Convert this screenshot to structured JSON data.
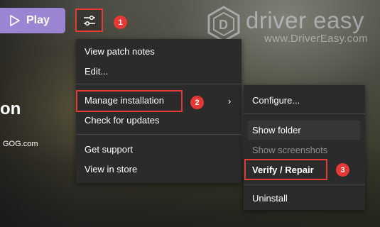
{
  "play_button": {
    "label": "Play"
  },
  "watermark": {
    "brand": "driver easy",
    "url": "www.DriverEasy.com"
  },
  "game": {
    "title_fragment": "on",
    "store": "GOG.com"
  },
  "steps": [
    "1",
    "2",
    "3"
  ],
  "menu": {
    "items": [
      {
        "label": "View patch notes"
      },
      {
        "label": "Edit..."
      },
      {
        "label": "Manage installation",
        "has_submenu": true
      },
      {
        "label": "Check for updates"
      },
      {
        "label": "Get support"
      },
      {
        "label": "View in store"
      }
    ]
  },
  "submenu": {
    "items": [
      {
        "label": "Configure..."
      },
      {
        "label": "Show folder"
      },
      {
        "label": "Show screenshots",
        "disabled": true
      },
      {
        "label": "Verify / Repair"
      },
      {
        "label": "Uninstall"
      }
    ]
  },
  "colors": {
    "play_button": "#9b84d1",
    "menu_bg": "#2b2b2b",
    "annotation_red": "#e53935"
  },
  "icons": [
    "play-icon",
    "settings-sliders-icon",
    "chevron-right-icon",
    "driver-easy-logo-icon"
  ]
}
